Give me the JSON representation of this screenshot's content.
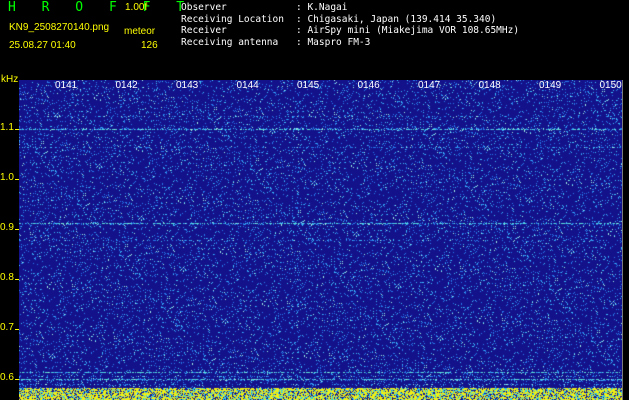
{
  "header": {
    "app_title": "H R O F F T",
    "version": "1.00f",
    "filename": "KN9_2508270140.png",
    "mode": "meteor",
    "timestamp": "25.08.27 01:40",
    "count": "126",
    "info": [
      {
        "label": "Observer",
        "value": ": K.Nagai"
      },
      {
        "label": "Receiving Location",
        "value": ": Chigasaki, Japan (139.414 35.340)"
      },
      {
        "label": "Receiver",
        "value": ": AirSpy mini (Miakejima VOR 108.65MHz)"
      },
      {
        "label": "Receiving antenna",
        "value": ": Maspro FM-3"
      }
    ]
  },
  "spectrogram": {
    "unit_label": "kHz",
    "y_ticks": [
      "1.1",
      "1.0",
      "0.9",
      "0.8",
      "0.7",
      "0.6"
    ],
    "x_ticks": [
      "0141",
      "0142",
      "0143",
      "0144",
      "0145",
      "0146",
      "0147",
      "0148",
      "0149",
      "0150"
    ],
    "colors": {
      "background": "#16128a",
      "noise": "#2196f3",
      "line": "#00e0e0",
      "signal": "#ffff00",
      "title": "#00ff00",
      "label_yellow": "#ffff00"
    }
  }
}
